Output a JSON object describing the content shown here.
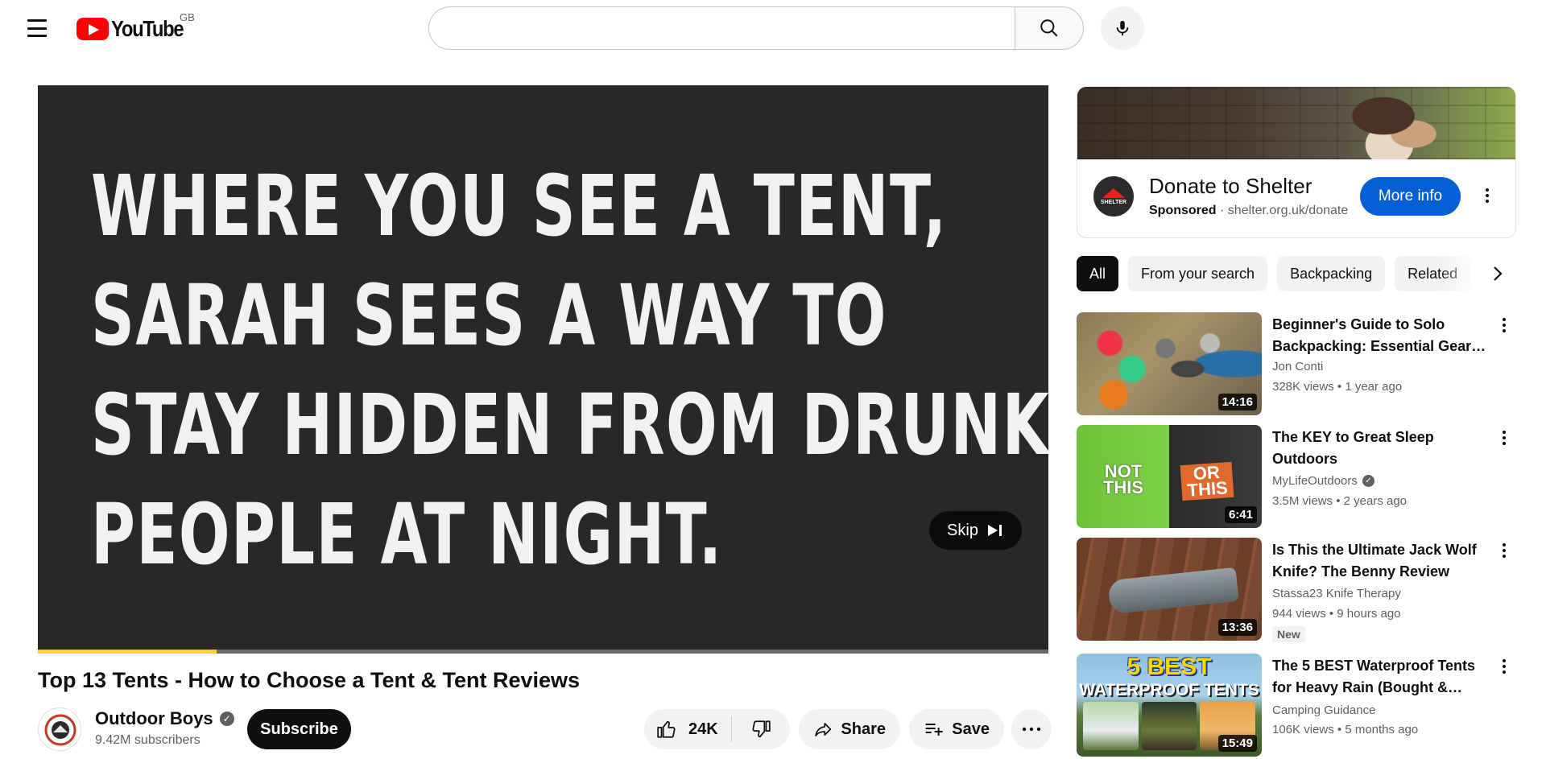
{
  "header": {
    "logo_text": "YouTube",
    "country_code": "GB",
    "search_placeholder": "",
    "icons": [
      "menu-icon",
      "search-icon",
      "microphone-icon"
    ]
  },
  "player": {
    "overlay_lines": [
      "WHERE YOU SEE A TENT,",
      "SARAH SEES A WAY TO",
      "STAY HIDDEN FROM DRUNK",
      "PEOPLE AT NIGHT."
    ],
    "skip_label": "Skip",
    "ad_progress": 0.177,
    "colors": {
      "background": "#282828",
      "progress": "#fcd12a"
    }
  },
  "video": {
    "title": "Top 13 Tents - How to Choose a Tent & Tent Reviews",
    "channel_name": "Outdoor Boys",
    "subscribers": "9.42M subscribers",
    "subscribe_label": "Subscribe",
    "likes": "24K",
    "share_label": "Share",
    "save_label": "Save"
  },
  "ad": {
    "title": "Donate to Shelter",
    "sponsored_label": "Sponsored",
    "separator": "·",
    "url": "shelter.org.uk/donate",
    "logo_text": "SHELTER",
    "cta_label": "More info",
    "colors": {
      "cta": "#065fd4",
      "logo_roof": "#e2231a"
    }
  },
  "chips": [
    "All",
    "From your search",
    "Backpacking",
    "Related"
  ],
  "related": [
    {
      "title": "Beginner's Guide to Solo Backpacking: Essential Gear…",
      "channel": "Jon Conti",
      "verified": false,
      "views": "328K views",
      "age": "1 year ago",
      "duration": "14:16",
      "badge": ""
    },
    {
      "title": "The KEY to Great Sleep Outdoors",
      "channel": "MyLifeOutdoors",
      "verified": true,
      "views": "3.5M views",
      "age": "2 years ago",
      "duration": "6:41",
      "badge": "",
      "thumb_text_left": "NOT THIS",
      "thumb_text_right": "OR THIS"
    },
    {
      "title": "Is This the Ultimate Jack Wolf Knife? The Benny Review",
      "channel": "Stassa23 Knife Therapy",
      "verified": false,
      "views": "944 views",
      "age": "9 hours ago",
      "duration": "13:36",
      "badge": "New"
    },
    {
      "title": "The 5 BEST Waterproof Tents for Heavy Rain (Bought &…",
      "channel": "Camping Guidance",
      "verified": false,
      "views": "106K views",
      "age": "5 months ago",
      "duration": "15:49",
      "badge": "",
      "thumb_text_top": "5 BEST",
      "thumb_text_bottom": "WATERPROOF TENTS"
    }
  ]
}
